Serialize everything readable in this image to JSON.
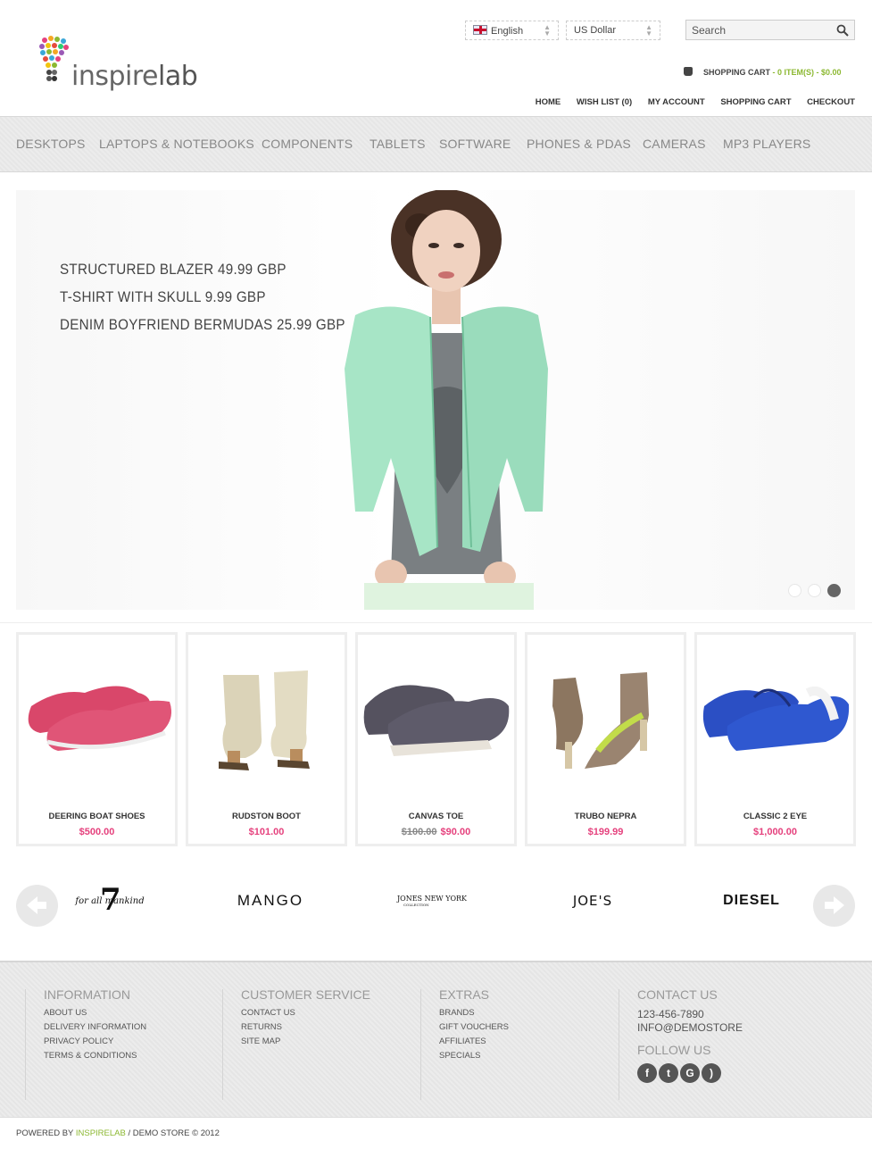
{
  "header": {
    "logo_text_1": "inspire",
    "logo_text_2": "lab",
    "language": "English",
    "currency": "US Dollar",
    "search_placeholder": "Search",
    "cart_label": "SHOPPING CART",
    "cart_summary": " - 0 ITEM(S) - $0.00",
    "top_links": [
      "HOME",
      "WISH LIST (0)",
      "MY ACCOUNT",
      "SHOPPING CART",
      "CHECKOUT"
    ]
  },
  "nav": {
    "items": [
      "DESKTOPS",
      "LAPTOPS & NOTEBOOKS",
      "COMPONENTS",
      "TABLETS",
      "SOFTWARE",
      "PHONES & PDAS",
      "CAMERAS",
      "MP3 PLAYERS"
    ]
  },
  "banner": {
    "lines": [
      "STRUCTURED BLAZER 49.99 GBP",
      "T-SHIRT WITH SKULL 9.99 GBP",
      "DENIM BOYFRIEND BERMUDAS 25.99 GBP"
    ],
    "slides": 3,
    "active_slide": 3
  },
  "products": [
    {
      "name": "DEERING BOAT SHOES",
      "price": "$500.00",
      "old_price": ""
    },
    {
      "name": "RUDSTON BOOT",
      "price": "$101.00",
      "old_price": ""
    },
    {
      "name": "CANVAS TOE",
      "price": "$90.00",
      "old_price": "$100.00"
    },
    {
      "name": "TRUBO NEPRA",
      "price": "$199.99",
      "old_price": ""
    },
    {
      "name": "CLASSIC 2 EYE",
      "price": "$1,000.00",
      "old_price": ""
    }
  ],
  "brands": [
    "for all mankind",
    "MANGO",
    "JONES NEW YORK",
    "JOE'S",
    "DIESEL"
  ],
  "brands_sub": {
    "jones": "COLLECTION",
    "seven": "7"
  },
  "footer": {
    "information": {
      "title": "INFORMATION",
      "links": [
        "ABOUT US",
        "DELIVERY INFORMATION",
        "PRIVACY POLICY",
        "TERMS & CONDITIONS"
      ]
    },
    "customer_service": {
      "title": "CUSTOMER SERVICE",
      "links": [
        "CONTACT US",
        "RETURNS",
        "SITE MAP"
      ]
    },
    "extras": {
      "title": "EXTRAS",
      "links": [
        "BRANDS",
        "GIFT VOUCHERS",
        "AFFILIATES",
        "SPECIALS"
      ]
    },
    "contact": {
      "title": "CONTACT US",
      "phone": "123-456-7890",
      "email": "INFO@DEMOSTORE",
      "follow_title": "FOLLOW US"
    },
    "social_icons": [
      "facebook-icon",
      "twitter-icon",
      "google-icon",
      "rss-icon"
    ]
  },
  "bottom": {
    "powered_prefix": "POWERED BY ",
    "powered_brand": "INSPIRELAB",
    "powered_suffix": " / DEMO STORE © 2012"
  },
  "colors": {
    "accent_green": "#8cb832",
    "price_pink": "#e5417d"
  }
}
